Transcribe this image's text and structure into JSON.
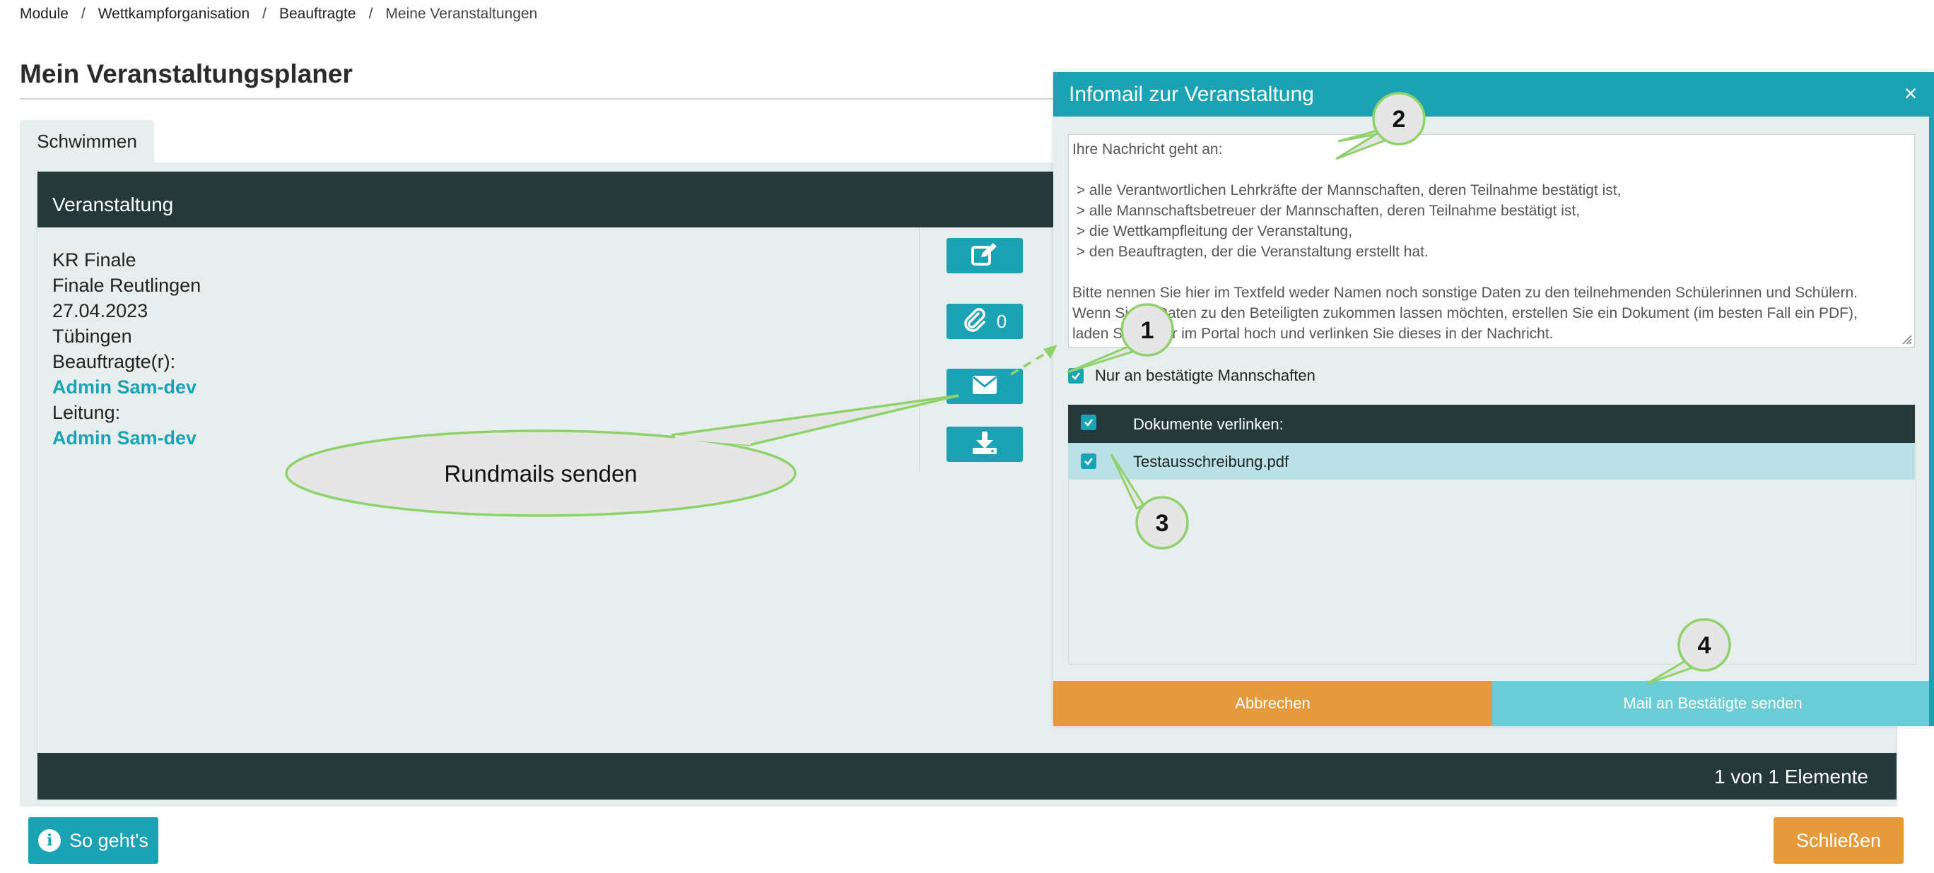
{
  "breadcrumb": {
    "items": [
      "Module",
      "Wettkampforganisation",
      "Beauftragte"
    ],
    "separator": "/",
    "current": "Meine Veranstaltungen"
  },
  "page": {
    "title": "Mein Veranstaltungsplaner"
  },
  "tabs": [
    {
      "label": "Schwimmen",
      "active": true
    }
  ],
  "table": {
    "header": "Veranstaltung",
    "event": {
      "name": "KR Finale",
      "venue": "Finale Reutlingen",
      "date": "27.04.2023",
      "city": "Tübingen",
      "commissioner_label": "Beauftragte(r):",
      "commissioner": "Admin Sam-dev",
      "lead_label": "Leitung:",
      "lead": "Admin Sam-dev"
    },
    "actions": {
      "edit_icon": "edit-icon",
      "attachment_icon": "paperclip-icon",
      "attachment_count": "0",
      "mail_icon": "envelope-icon",
      "download_icon": "download-icon"
    },
    "footer": "1 von 1 Elemente"
  },
  "footer": {
    "help_label": "So geht's",
    "close_label": "Schließen"
  },
  "modal": {
    "title": "Infomail zur Veranstaltung",
    "close_symbol": "×",
    "message": "Ihre Nachricht geht an:\n\n > alle Verantwortlichen Lehrkräfte der Mannschaften, deren Teilnahme bestätigt ist,\n > alle Mannschaftsbetreuer der Mannschaften, deren Teilnahme bestätigt ist,\n > die Wettkampfleitung der Veranstaltung,\n > den Beauftragten, der die Veranstaltung erstellt hat.\n\nBitte nennen Sie hier im Textfeld weder Namen noch sonstige Daten zu den teilnehmenden Schülerinnen und Schülern.\nWenn Sie     Daten zu den Beteiligten zukommen lassen möchten, erstellen Sie ein Dokument (im besten Fall ein PDF),\nladen S          er im Portal hoch und verlinken Sie dieses in der Nachricht.",
    "only_confirmed_label": "Nur an bestätigte Mannschaften",
    "only_confirmed_checked": true,
    "documents_header": "Dokumente verlinken:",
    "documents": [
      {
        "name": "Testausschreibung.pdf",
        "checked": true
      }
    ],
    "cancel_label": "Abbrechen",
    "send_label": "Mail an Bestätigte senden"
  },
  "annotations": {
    "callout_text": "Rundmails senden",
    "markers": [
      "1",
      "2",
      "3",
      "4"
    ]
  },
  "colors": {
    "accent": "#1ba3b4",
    "dark": "#25393a",
    "orange": "#e59a3c",
    "light_teal": "#6ccdd6",
    "annotation_green": "#8fd16a"
  }
}
